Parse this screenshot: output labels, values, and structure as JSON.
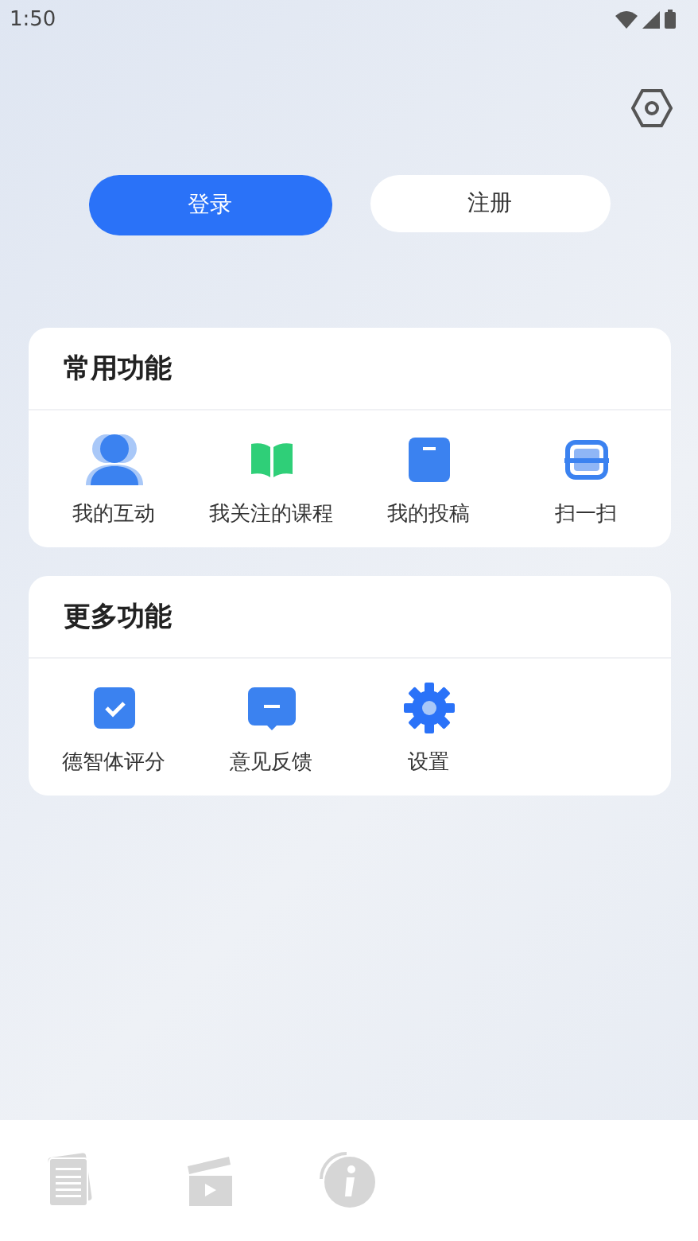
{
  "status_bar": {
    "time": "1:50"
  },
  "auth_buttons": [
    {
      "label": "登录",
      "kind": "primary"
    },
    {
      "label": "注册",
      "kind": "secondary"
    }
  ],
  "sections": [
    {
      "title": "常用功能",
      "items": [
        {
          "label": "我的互动",
          "kind": "person"
        },
        {
          "label": "我关注的课程",
          "kind": "book"
        },
        {
          "label": "我的投稿",
          "kind": "document"
        },
        {
          "label": "扫一扫",
          "kind": "scan"
        }
      ]
    },
    {
      "title": "更多功能",
      "items": [
        {
          "label": "德智体评分",
          "kind": "check"
        },
        {
          "label": "意见反馈",
          "kind": "message"
        },
        {
          "label": "设置",
          "kind": "gear"
        }
      ]
    }
  ],
  "bottom_nav": [
    {
      "kind": "news",
      "selected": false
    },
    {
      "kind": "video",
      "selected": false
    },
    {
      "kind": "info",
      "selected": false
    }
  ]
}
